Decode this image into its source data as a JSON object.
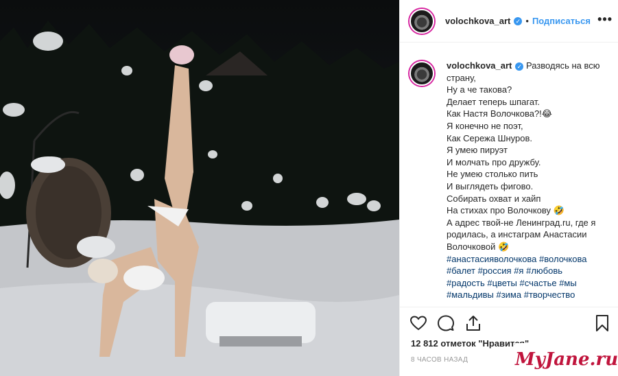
{
  "post": {
    "username": "volochkova_art",
    "follow_label": "Подписаться",
    "more_label": "•••",
    "verified_mark": "✓",
    "separator": "•"
  },
  "caption": {
    "username": "volochkova_art",
    "first_line": "Разводясь на всю",
    "lines": [
      "страну,",
      "Ну а че такова?",
      "Делает теперь шпагат.",
      "Как Настя Волочкова?!😂",
      "Я конечно не поэт,",
      "Как Сережа Шнуров.",
      "Я умею пируэт",
      "И молчать про дружбу.",
      "Не умею столько пить",
      "И выглядеть фигово.",
      "Собирать охват и хайп",
      "На стихах про Волочкову 🤣"
    ],
    "wrap_lines": [
      "А адрес твой-не Ленинград.ru, где я родилась, а инстаграм Анастасии Волочковой 🤣"
    ],
    "hashtag_lines": [
      [
        "#анастасияволочкова",
        "#волочкова"
      ],
      [
        "#балет",
        "#россия",
        "#я",
        "#любовь"
      ],
      [
        "#радость",
        "#цветы",
        "#счастье",
        "#мы"
      ],
      [
        "#мальдивы",
        "#зима",
        "#творчество"
      ]
    ]
  },
  "footer": {
    "likes": "12 812 отметок \"Нравится\"",
    "time_ago": "8 ЧАСОВ НАЗАД"
  },
  "icons": {
    "like": "heart-icon",
    "comment": "comment-icon",
    "share": "share-icon",
    "save": "bookmark-icon"
  },
  "watermark": "MyJane.ru",
  "colors": {
    "accent": "#3897f0",
    "hashtag": "#003569",
    "watermark": "#c0143c"
  }
}
